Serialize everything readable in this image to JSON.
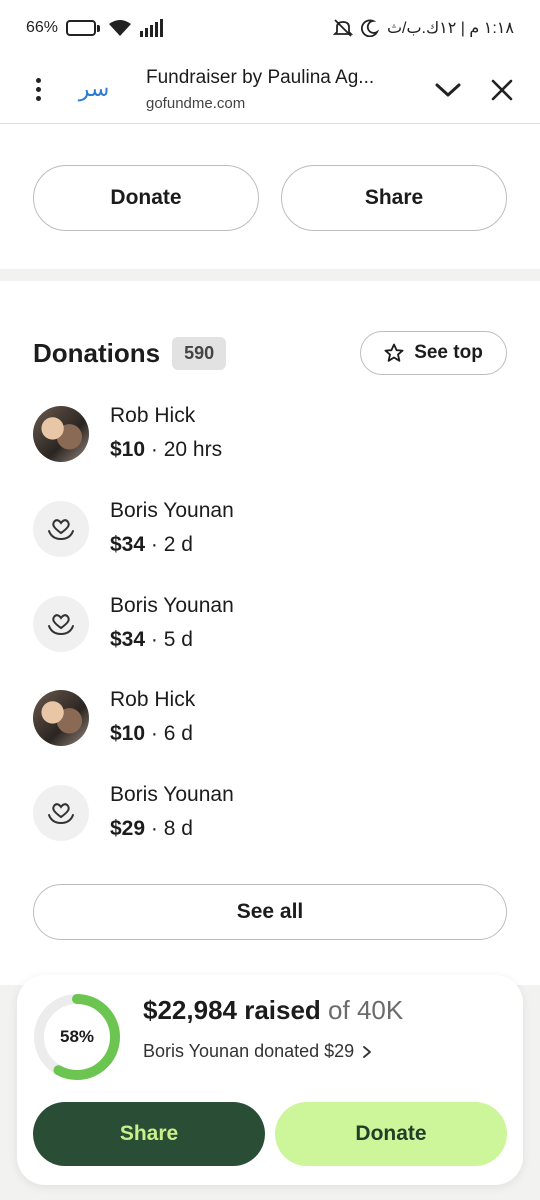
{
  "status_bar": {
    "battery": "66%",
    "battery_level": 0.66,
    "time": "١:١٨ م | ١٢ك.ب/ث"
  },
  "browser": {
    "logo_text": "سر",
    "title": "Fundraiser by Paulina Ag...",
    "domain": "gofundme.com"
  },
  "top_actions": {
    "donate_label": "Donate",
    "share_label": "Share"
  },
  "donations": {
    "title": "Donations",
    "count": "590",
    "see_top_label": "See top",
    "items": [
      {
        "name": "Rob Hick",
        "amount": "$10",
        "time": "20 hrs",
        "avatar": "photo"
      },
      {
        "name": "Boris Younan",
        "amount": "$34",
        "time": "2 d",
        "avatar": "heart-hand-icon"
      },
      {
        "name": "Boris Younan",
        "amount": "$34",
        "time": "5 d",
        "avatar": "heart-hand-icon"
      },
      {
        "name": "Rob Hick",
        "amount": "$10",
        "time": "6 d",
        "avatar": "photo"
      },
      {
        "name": "Boris Younan",
        "amount": "$29",
        "time": "8 d",
        "avatar": "heart-hand-icon"
      }
    ],
    "see_all_label": "See all"
  },
  "summary": {
    "progress_percent": "58%",
    "progress_value": 0.58,
    "raised": "$22,984 raised",
    "goal": "of 40K",
    "recent": "Boris Younan donated $29",
    "share_label": "Share",
    "donate_label": "Donate"
  },
  "colors": {
    "progress": "#6cc551",
    "share_bg": "#2a4d35",
    "donate_bg": "#cdf59a"
  }
}
